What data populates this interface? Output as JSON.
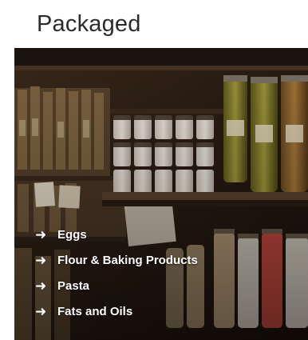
{
  "section": {
    "title": "Packaged"
  },
  "colors": {
    "banner_background": "#ffffff",
    "title_text": "#2b2b2b",
    "link_text": "#ffffff",
    "photo_base": "#2a1d14"
  },
  "links": [
    {
      "icon": "arrow-right-icon",
      "label": "Eggs"
    },
    {
      "icon": "arrow-right-icon",
      "label": "Flour & Baking Products"
    },
    {
      "icon": "arrow-right-icon",
      "label": "Pasta"
    },
    {
      "icon": "arrow-right-icon",
      "label": "Fats and Oils"
    }
  ]
}
